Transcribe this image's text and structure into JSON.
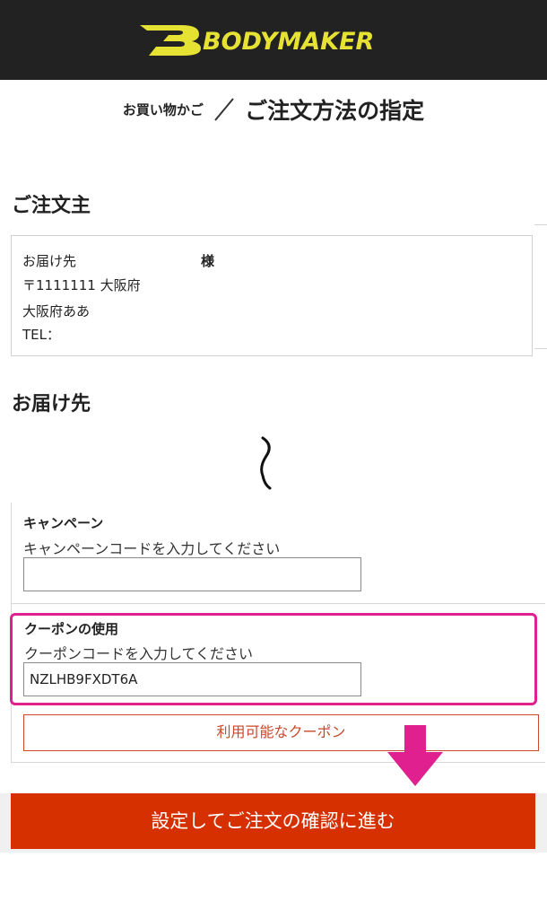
{
  "header": {
    "brand": "BODYMAKER",
    "brand_color": "#e6e233",
    "background": "#222222"
  },
  "breadcrumb": {
    "cart": "お買い物かご",
    "current": "ご注文方法の指定"
  },
  "orderer": {
    "heading": "ご注文主",
    "label": "お届け先",
    "honorific": "様",
    "postal_pref": "〒1111111 大阪府",
    "address": "大阪府ああ",
    "tel": "TEL："
  },
  "delivery": {
    "heading": "お届け先"
  },
  "campaign": {
    "label": "キャンペーン",
    "hint": "キャンペーンコードを入力してください",
    "value": ""
  },
  "coupon": {
    "label": "クーポンの使用",
    "hint": "クーポンコードを入力してください",
    "value": "NZLHB9FXDT6A",
    "highlight_color": "#e0208f",
    "available_button": "利用可能なクーポン"
  },
  "actions": {
    "confirm": "設定してご注文の確認に進む",
    "confirm_color": "#d63000"
  },
  "icons": {
    "arrow": "arrow-down-icon",
    "omission": "omission-wave-icon"
  }
}
